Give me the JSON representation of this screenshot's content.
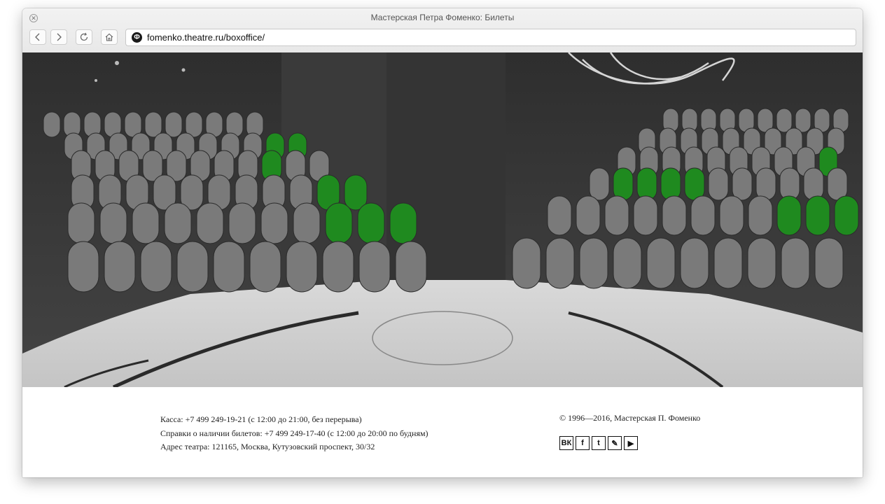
{
  "window": {
    "title": "Мастерская Петра Фоменко: Билеты",
    "url": "fomenko.theatre.ru/boxoffice/"
  },
  "toolbar": {
    "close_icon": "close-icon",
    "back_icon": "chevron-left-icon",
    "forward_icon": "chevron-right-icon",
    "reload_icon": "reload-icon",
    "home_icon": "home-icon"
  },
  "hero": {
    "description_icon": "theatre-seating-map",
    "highlight_color": "#1f8a1f"
  },
  "footer": {
    "box_office": "Касса: +7 499 249-19-21 (с 12:00 до 21:00, без перерыва)",
    "availability": "Справки о наличии билетов: +7 499 249-17-40 (с 12:00 до 20:00 по будням)",
    "address": "Адрес театра: 121165, Москва, Кутузовский проспект, 30/32",
    "copyright": "© 1996—2016, Мастерская П. Фоменко",
    "social": [
      {
        "icon": "vk-icon",
        "label": "ВК"
      },
      {
        "icon": "facebook-icon",
        "label": "f"
      },
      {
        "icon": "twitter-icon",
        "label": "t"
      },
      {
        "icon": "livejournal-icon",
        "label": "✎"
      },
      {
        "icon": "youtube-icon",
        "label": "▶"
      }
    ]
  }
}
